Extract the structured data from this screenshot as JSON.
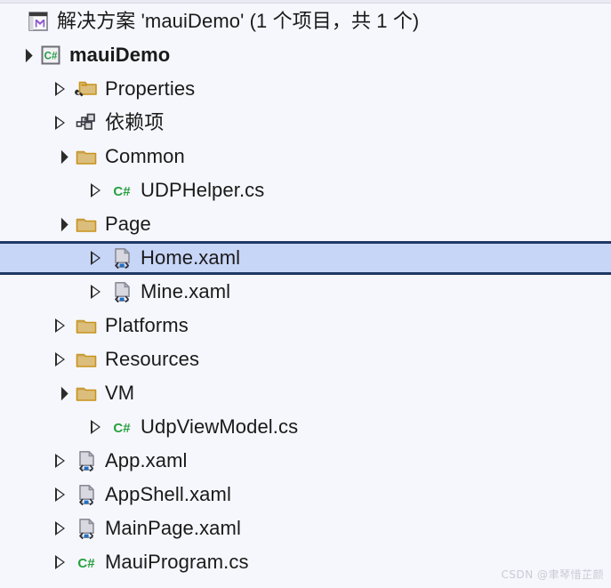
{
  "panel": {
    "name": "solution-explorer",
    "background_color": "#F6F7FC",
    "selection_fill": "#C7D5F7",
    "selection_border": "#1F3864"
  },
  "header": {
    "icon": "solution-icon",
    "title": "解决方案 'mauiDemo' (1 个项目，共 1 个)"
  },
  "tree": [
    {
      "id": "maui-demo-project",
      "label": "mauiDemo",
      "icon": "csharp-project-icon",
      "indent": 0,
      "expander": "expanded",
      "bold": true,
      "selected": false
    },
    {
      "id": "properties",
      "label": "Properties",
      "icon": "properties-folder-icon",
      "indent": 1,
      "expander": "collapsed",
      "bold": false,
      "selected": false
    },
    {
      "id": "dependencies",
      "label": "依赖项",
      "icon": "dependencies-icon",
      "indent": 1,
      "expander": "collapsed",
      "bold": false,
      "selected": false
    },
    {
      "id": "common-folder",
      "label": "Common",
      "icon": "folder-icon",
      "indent": 1,
      "expander": "expanded",
      "bold": false,
      "selected": false
    },
    {
      "id": "udphelper-cs",
      "label": "UDPHelper.cs",
      "icon": "csharp-file-icon",
      "indent": 2,
      "expander": "collapsed",
      "bold": false,
      "selected": false
    },
    {
      "id": "page-folder",
      "label": "Page",
      "icon": "folder-icon",
      "indent": 1,
      "expander": "expanded",
      "bold": false,
      "selected": false
    },
    {
      "id": "home-xaml",
      "label": "Home.xaml",
      "icon": "xaml-file-icon",
      "indent": 2,
      "expander": "collapsed",
      "bold": false,
      "selected": true
    },
    {
      "id": "mine-xaml",
      "label": "Mine.xaml",
      "icon": "xaml-file-icon",
      "indent": 2,
      "expander": "collapsed",
      "bold": false,
      "selected": false
    },
    {
      "id": "platforms-folder",
      "label": "Platforms",
      "icon": "folder-icon",
      "indent": 1,
      "expander": "collapsed",
      "bold": false,
      "selected": false
    },
    {
      "id": "resources-folder",
      "label": "Resources",
      "icon": "folder-icon",
      "indent": 1,
      "expander": "collapsed",
      "bold": false,
      "selected": false
    },
    {
      "id": "vm-folder",
      "label": "VM",
      "icon": "folder-icon",
      "indent": 1,
      "expander": "expanded",
      "bold": false,
      "selected": false
    },
    {
      "id": "udpviewmodel-cs",
      "label": "UdpViewModel.cs",
      "icon": "csharp-file-icon",
      "indent": 2,
      "expander": "collapsed",
      "bold": false,
      "selected": false
    },
    {
      "id": "app-xaml",
      "label": "App.xaml",
      "icon": "xaml-file-icon",
      "indent": 1,
      "expander": "collapsed",
      "bold": false,
      "selected": false
    },
    {
      "id": "appshell-xaml",
      "label": "AppShell.xaml",
      "icon": "xaml-file-icon",
      "indent": 1,
      "expander": "collapsed",
      "bold": false,
      "selected": false
    },
    {
      "id": "mainpage-xaml",
      "label": "MainPage.xaml",
      "icon": "xaml-file-icon",
      "indent": 1,
      "expander": "collapsed",
      "bold": false,
      "selected": false
    },
    {
      "id": "mauiprogram-cs",
      "label": "MauiProgram.cs",
      "icon": "csharp-file-icon",
      "indent": 1,
      "expander": "collapsed",
      "bold": false,
      "selected": false
    }
  ],
  "watermark": {
    "text": "CSDN @聿琴惜芷颜"
  }
}
